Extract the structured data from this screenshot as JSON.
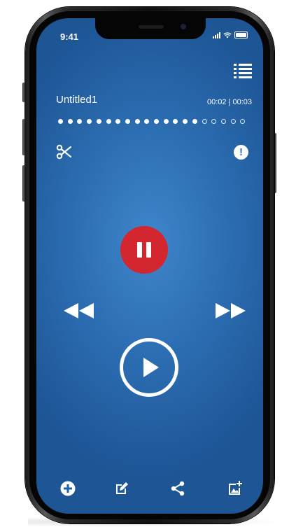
{
  "status_bar": {
    "time": "9:41"
  },
  "recording": {
    "name": "Untitled1",
    "time_display": "00:02 | 00:03",
    "progress": {
      "filled_dots": 15,
      "total_dots": 20
    }
  },
  "colors": {
    "background": "#2d6fb4",
    "pause_button": "#d3262e",
    "foreground": "#ffffff"
  },
  "icons": {
    "recordings_list": "list-icon",
    "edit_cut": "scissors-icon",
    "info": "info-icon",
    "pause": "pause-icon",
    "rewind": "rewind-icon",
    "fast_forward": "fast-forward-icon",
    "play": "play-icon",
    "bottom_toolbar": [
      "add-icon",
      "edit-icon",
      "share-icon",
      "add-image-icon"
    ]
  },
  "info_glyph": "!"
}
